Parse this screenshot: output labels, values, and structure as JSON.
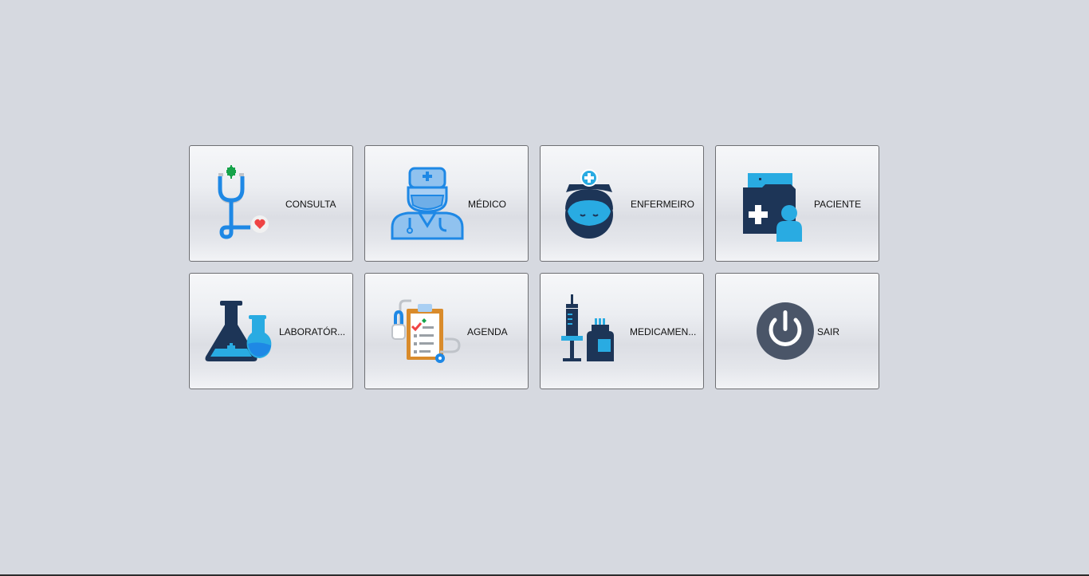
{
  "menu": {
    "tiles": [
      {
        "label": "CONSULTA",
        "icon": "stethoscope-icon"
      },
      {
        "label": "MÉDICO",
        "icon": "doctor-icon"
      },
      {
        "label": "ENFERMEIRO",
        "icon": "nurse-icon"
      },
      {
        "label": "PACIENTE",
        "icon": "patient-folder-icon"
      },
      {
        "label": "LABORATÓR...",
        "icon": "lab-flask-icon"
      },
      {
        "label": "AGENDA",
        "icon": "clipboard-icon"
      },
      {
        "label": "MEDICAMEN...",
        "icon": "syringe-medicine-icon"
      },
      {
        "label": "SAIR",
        "icon": "power-icon"
      }
    ]
  },
  "colors": {
    "background": "#d6d9e0",
    "navy": "#1d3557",
    "blue": "#1e88e5",
    "cyan": "#29abe2",
    "green": "#16a34a",
    "red": "#ef4444",
    "orange": "#d98b2b",
    "power_circle": "#4a5568"
  }
}
